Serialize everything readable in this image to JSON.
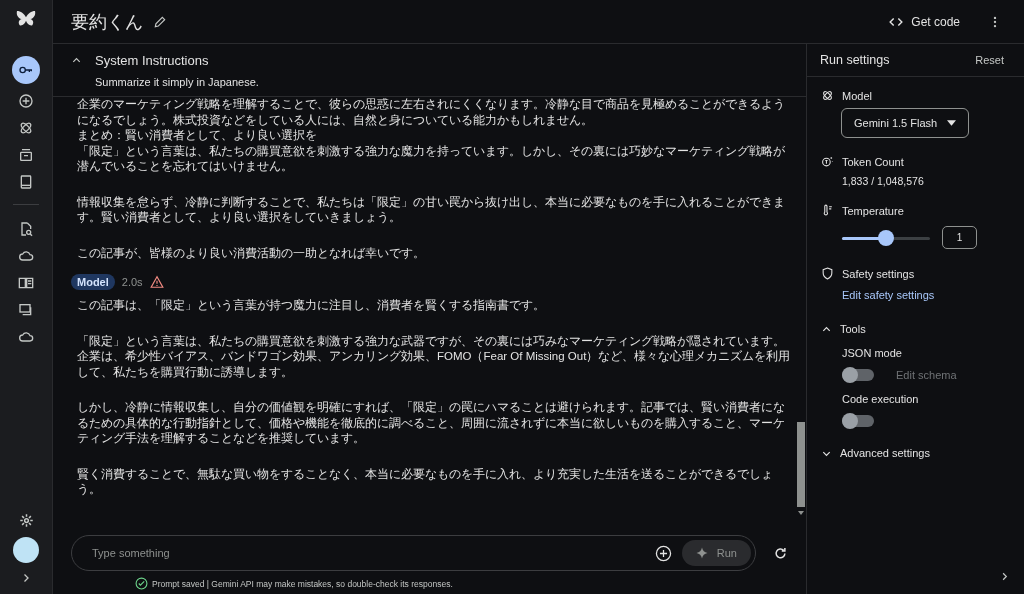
{
  "app": {
    "title": "要約くん"
  },
  "header": {
    "get_code": "Get code"
  },
  "nav": [
    {
      "kind": "key",
      "selected": true
    },
    {
      "kind": "add",
      "selected": false
    },
    {
      "kind": "model",
      "selected": false
    },
    {
      "kind": "archive",
      "selected": false
    },
    {
      "kind": "book",
      "selected": false
    }
  ],
  "nav_lower": [
    {
      "kind": "doc-search",
      "selected": false
    },
    {
      "kind": "cloud",
      "selected": false
    },
    {
      "kind": "reader",
      "selected": false
    },
    {
      "kind": "chat",
      "selected": false
    },
    {
      "kind": "cloud",
      "selected": false
    }
  ],
  "system_instructions": {
    "title": "System Instructions",
    "text": "Summarize it simply in Japanese.",
    "expanded": true
  },
  "earlier_reply": {
    "paragraphs": [
      [
        "企業のマーケティング戦略を理解することで、彼らの思惑に左右されにくくなります。冷静な目で商品を見極めることができるようになるでしょう。株式投資などをしている人には、自然と身についている能力かもしれません。",
        "まとめ：賢い消費者として、より良い選択を",
        "「限定」という言葉は、私たちの購買意欲を刺激する強力な魔力を持っています。しかし、その裏には巧妙なマーケティング戦略が潜んでいることを忘れてはいけません。"
      ],
      [
        "情報収集を怠らず、冷静に判断することで、私たちは「限定」の甘い罠から抜け出し、本当に必要なものを手に入れることができます。賢い消費者として、より良い選択をしていきましょう。"
      ],
      [
        "この記事が、皆様のより良い消費活動の一助となれば幸いです。"
      ]
    ]
  },
  "model_reply": {
    "badge": "Model",
    "time": "2.0s",
    "warning": true,
    "paragraphs": [
      [
        "この記事は、「限定」という言葉が持つ魔力に注目し、消費者を賢くする指南書です。"
      ],
      [
        "「限定」という言葉は、私たちの購買意欲を刺激する強力な武器ですが、その裏には巧みなマーケティング戦略が隠されています。企業は、希少性バイアス、バンドワゴン効果、アンカリング効果、FOMO（Fear Of Missing Out）など、様々な心理メカニズムを利用して、私たちを購買行動に誘導します。"
      ],
      [
        "しかし、冷静に情報収集し、自分の価値観を明確にすれば、「限定」の罠にハマることは避けられます。記事では、賢い消費者になるための具体的な行動指針として、価格や機能を徹底的に調べること、周囲に流されずに本当に欲しいものを購入すること、マーケティング手法を理解することなどを推奨しています。"
      ],
      [
        "賢く消費することで、無駄な買い物をすることなく、本当に必要なものを手に入れ、より充実した生活を送ることができるでしょう。"
      ]
    ]
  },
  "composer": {
    "placeholder": "Type something",
    "run": "Run"
  },
  "footer_note": "Prompt saved | Gemini API may make mistakes, so double-check its responses.",
  "settings": {
    "title": "Run settings",
    "reset": "Reset",
    "model": {
      "label": "Model",
      "value": "Gemini 1.5 Flash"
    },
    "token_count": {
      "label": "Token Count",
      "value": "1,833 / 1,048,576"
    },
    "temperature": {
      "label": "Temperature",
      "level": 0.5,
      "value": "1"
    },
    "safety": {
      "label": "Safety settings",
      "link": "Edit safety settings"
    },
    "tools": {
      "label": "Tools",
      "expanded": true,
      "items": [
        {
          "label": "JSON mode",
          "on": false,
          "action": "Edit schema"
        },
        {
          "label": "Code execution",
          "on": false
        }
      ]
    },
    "advanced": {
      "label": "Advanced settings",
      "expanded": false
    }
  }
}
